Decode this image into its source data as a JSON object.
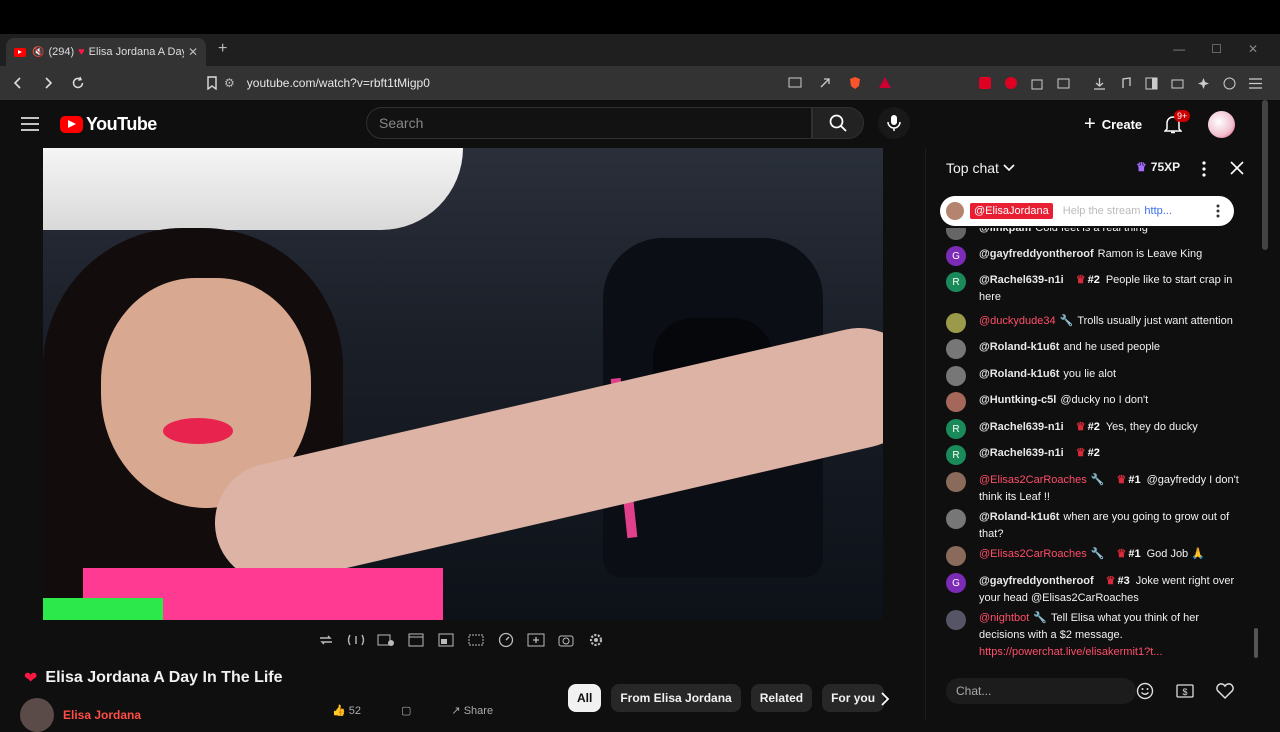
{
  "browser": {
    "tab": {
      "count_label": "(294)",
      "title": "Elisa Jordana A Day In The Life"
    },
    "url": "youtube.com/watch?v=rbft1tMigp0"
  },
  "header": {
    "logo_text": "YouTube",
    "search_placeholder": "Search",
    "create_label": "Create",
    "notifications_badge": "9+"
  },
  "video": {
    "title": "Elisa Jordana A Day In The Life",
    "channel": "Elisa Jordana",
    "partial_like_count": "52",
    "partial_share_label": "Share"
  },
  "chips": [
    "All",
    "From Elisa Jordana",
    "Related",
    "For you"
  ],
  "chat": {
    "mode_label": "Top chat",
    "xp_label": "75XP",
    "pinned": {
      "author": "@ElisaJordana",
      "text": "Help the stream",
      "link": "http..."
    },
    "input_placeholder": "Chat...",
    "messages": [
      {
        "author": "@linkpam",
        "text": "Cold feet is a real thing",
        "avatar": "",
        "avatar_color": "#666"
      },
      {
        "author": "@gayfreddyontheroof",
        "text": "Ramon is Leave King",
        "avatar": "G",
        "avatar_color": "#7b2bb5"
      },
      {
        "author": "@Rachel639-n1i",
        "rank": "#2",
        "text": "People like to start crap in here",
        "avatar": "R",
        "avatar_color": "#1b8a5a"
      },
      {
        "author": "@duckydude34",
        "red": true,
        "text": "Trolls usually just want attention",
        "avatar": "",
        "avatar_color": "#9a9a4a"
      },
      {
        "author": "@Roland-k1u6t",
        "text": "and he used people",
        "avatar": "",
        "avatar_color": "#777"
      },
      {
        "author": "@Roland-k1u6t",
        "text": "you lie alot",
        "avatar": "",
        "avatar_color": "#777"
      },
      {
        "author": "@Huntking-c5l",
        "text": "@ducky no I don't",
        "avatar": "",
        "avatar_color": "#a5675a"
      },
      {
        "author": "@Rachel639-n1i",
        "rank": "#2",
        "text": "Yes, they do ducky",
        "avatar": "R",
        "avatar_color": "#1b8a5a"
      },
      {
        "author": "@Rachel639-n1i",
        "rank": "#2",
        "text": "",
        "avatar": "R",
        "avatar_color": "#1b8a5a"
      },
      {
        "author": "@Elisas2CarRoaches",
        "red": true,
        "rank": "#1",
        "text": "@gayfreddy I don't think its Leaf !!",
        "avatar": "",
        "avatar_color": "#8a6a5a"
      },
      {
        "author": "@Roland-k1u6t",
        "text": "when are you going to grow out of that?",
        "avatar": "",
        "avatar_color": "#777"
      },
      {
        "author": "@Elisas2CarRoaches",
        "red": true,
        "rank": "#1",
        "text": "God Job 🙏",
        "avatar": "",
        "avatar_color": "#8a6a5a"
      },
      {
        "author": "@gayfreddyontheroof",
        "rank": "#3",
        "text": "Joke went right over your head @Elisas2CarRoaches",
        "avatar": "G",
        "avatar_color": "#7b2bb5"
      },
      {
        "author": "@nightbot",
        "red": true,
        "text": "Tell Elisa what you think of her decisions with a $2 message.",
        "link": "https://powerchat.live/elisakermit1?t...",
        "avatar": "",
        "avatar_color": "#556"
      }
    ]
  }
}
